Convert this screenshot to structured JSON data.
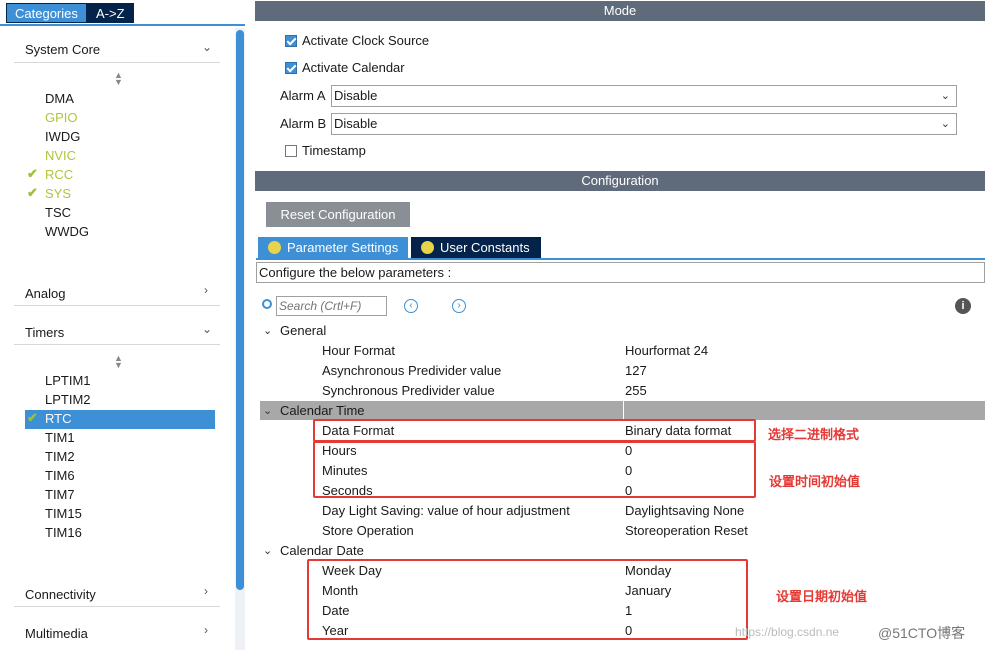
{
  "tabs": {
    "categories": "Categories",
    "az": "A->Z"
  },
  "sidebar": {
    "system_core": "System Core",
    "system_core_items": [
      "DMA",
      "GPIO",
      "IWDG",
      "NVIC",
      "RCC",
      "SYS",
      "TSC",
      "WWDG"
    ],
    "analog": "Analog",
    "timers": "Timers",
    "timers_items": [
      "LPTIM1",
      "LPTIM2",
      "RTC",
      "TIM1",
      "TIM2",
      "TIM6",
      "TIM7",
      "TIM15",
      "TIM16"
    ],
    "connectivity": "Connectivity",
    "multimedia": "Multimedia"
  },
  "mode": {
    "header": "Mode",
    "activate_clock": "Activate Clock Source",
    "activate_calendar": "Activate Calendar",
    "alarm_a_label": "Alarm A",
    "alarm_a_value": "Disable",
    "alarm_b_label": "Alarm B",
    "alarm_b_value": "Disable",
    "timestamp": "Timestamp"
  },
  "config": {
    "header": "Configuration",
    "reset_button": "Reset Configuration",
    "tab_params": "Parameter Settings",
    "tab_user": "User Constants",
    "configure_text": "Configure the below parameters :",
    "search_placeholder": "Search (Crtl+F)",
    "info_icon": "i"
  },
  "params": {
    "general": "General",
    "general_rows": [
      {
        "label": "Hour Format",
        "value": "Hourformat 24"
      },
      {
        "label": "Asynchronous Predivider value",
        "value": "127"
      },
      {
        "label": "Synchronous Predivider value",
        "value": "255"
      }
    ],
    "calendar_time": "Calendar Time",
    "calendar_time_rows": [
      {
        "label": "Data Format",
        "value": "Binary data format"
      },
      {
        "label": "Hours",
        "value": "0"
      },
      {
        "label": "Minutes",
        "value": "0"
      },
      {
        "label": "Seconds",
        "value": "0"
      },
      {
        "label": "Day Light Saving: value of hour adjustment",
        "value": "Daylightsaving None"
      },
      {
        "label": "Store Operation",
        "value": "Storeoperation Reset"
      }
    ],
    "calendar_date": "Calendar Date",
    "calendar_date_rows": [
      {
        "label": "Week Day",
        "value": "Monday"
      },
      {
        "label": "Month",
        "value": "January"
      },
      {
        "label": "Date",
        "value": "1"
      },
      {
        "label": "Year",
        "value": "0"
      }
    ]
  },
  "annotations": {
    "binary": "选择二进制格式",
    "time": "设置时间初始值",
    "date": "设置日期初始值"
  },
  "watermark": {
    "left": "https://blog.csdn.ne",
    "right": "@51CTO博客"
  },
  "colors": {
    "accent_check": "#9ac23c",
    "gpio_highlight": "#b3c43a",
    "selected_bg": "#3d8fd6",
    "annotation_red": "#e53935"
  }
}
